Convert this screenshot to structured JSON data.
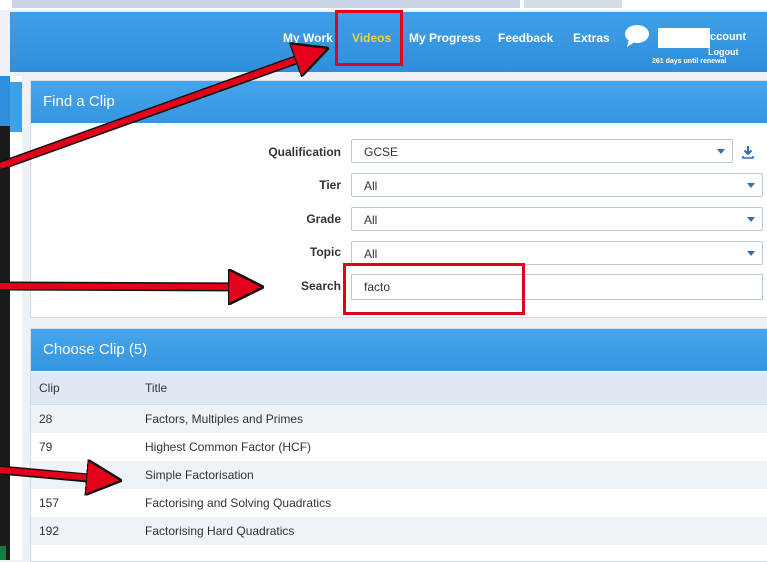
{
  "nav": {
    "items": [
      {
        "label": "My Work",
        "active": false
      },
      {
        "label": "Videos",
        "active": true
      },
      {
        "label": "My Progress",
        "active": false
      },
      {
        "label": "Feedback",
        "active": false
      },
      {
        "label": "Extras",
        "active": false
      }
    ],
    "account_label": "ccount",
    "logout_label": "Logout",
    "renewal_text": "261 days until renewal"
  },
  "find_clip": {
    "title": "Find a Clip",
    "fields": {
      "qualification": {
        "label": "Qualification",
        "value": "GCSE"
      },
      "tier": {
        "label": "Tier",
        "value": "All"
      },
      "grade": {
        "label": "Grade",
        "value": "All"
      },
      "topic": {
        "label": "Topic",
        "value": "All"
      },
      "search": {
        "label": "Search",
        "value": "facto"
      }
    }
  },
  "choose_clip": {
    "title": "Choose Clip (5)",
    "columns": [
      "Clip",
      "Title"
    ],
    "rows": [
      {
        "clip": "28",
        "title": "Factors, Multiples and Primes"
      },
      {
        "clip": "79",
        "title": "Highest Common Factor (HCF)"
      },
      {
        "clip": "",
        "title": "Simple Factorisation"
      },
      {
        "clip": "157",
        "title": "Factorising and Solving Quadratics"
      },
      {
        "clip": "192",
        "title": "Factorising Hard Quadratics"
      }
    ]
  },
  "colors": {
    "header_blue": "#2f8edb",
    "active_nav": "#f3d23c",
    "annotation_red": "#e3001b"
  }
}
